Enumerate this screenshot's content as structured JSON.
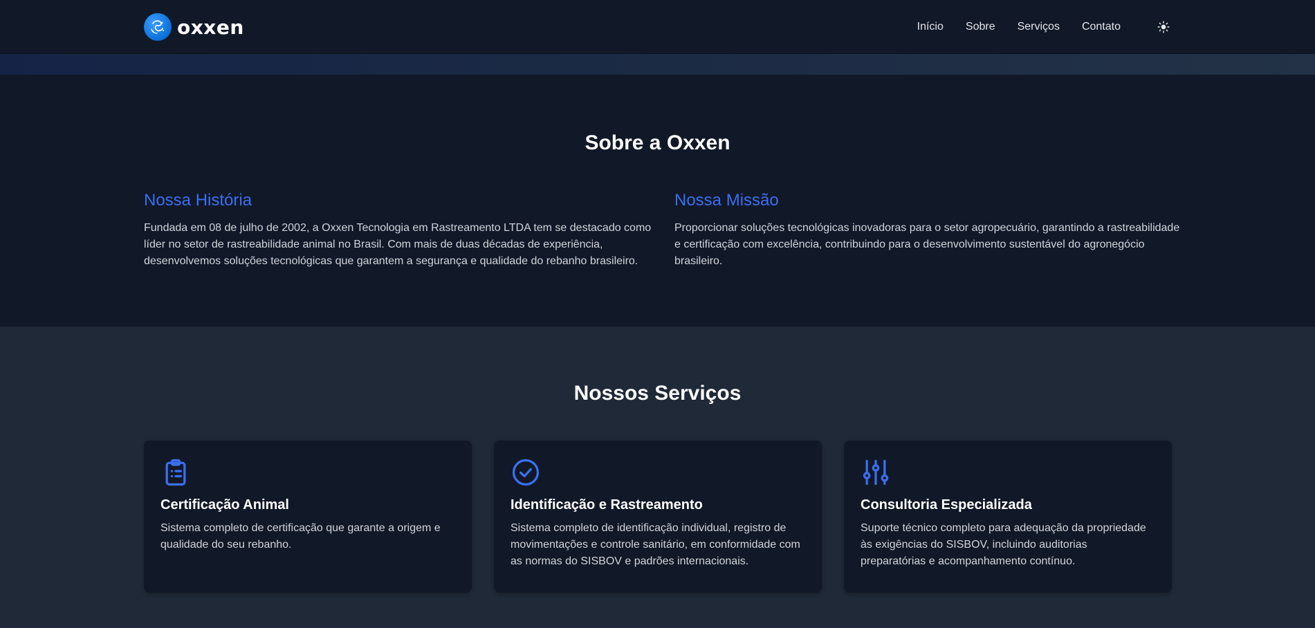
{
  "header": {
    "logo_text": "oxxen",
    "nav": [
      "Início",
      "Sobre",
      "Serviços",
      "Contato"
    ],
    "theme_icon": "sun-icon"
  },
  "about": {
    "title": "Sobre a Oxxen",
    "history": {
      "title": "Nossa História",
      "text": "Fundada em 08 de julho de 2002, a Oxxen Tecnologia em Rastreamento LTDA tem se destacado como líder no setor de rastreabilidade animal no Brasil. Com mais de duas décadas de experiência, desenvolvemos soluções tecnológicas que garantem a segurança e qualidade do rebanho brasileiro."
    },
    "mission": {
      "title": "Nossa Missão",
      "text": "Proporcionar soluções tecnológicas inovadoras para o setor agropecuário, garantindo a rastreabilidade e certificação com excelência, contribuindo para o desenvolvimento sustentável do agronegócio brasileiro."
    }
  },
  "services": {
    "title": "Nossos Serviços",
    "items": [
      {
        "icon": "clipboard-list-icon",
        "title": "Certificação Animal",
        "text": "Sistema completo de certificação que garante a origem e qualidade do seu rebanho."
      },
      {
        "icon": "check-circle-icon",
        "title": "Identificação e Rastreamento",
        "text": "Sistema completo de identificação individual, registro de movimentações e controle sanitário, em conformidade com as normas do SISBOV e padrões internacionais."
      },
      {
        "icon": "sliders-icon",
        "title": "Consultoria Especializada",
        "text": "Suporte técnico completo para adequação da propriedade às exigências do SISBOV, incluindo auditorias preparatórias e acompanhamento contínuo."
      }
    ]
  },
  "colors": {
    "accent": "#3b6ff0",
    "header_bg": "#111827",
    "services_bg": "#1f2937",
    "card_bg": "#111827"
  }
}
